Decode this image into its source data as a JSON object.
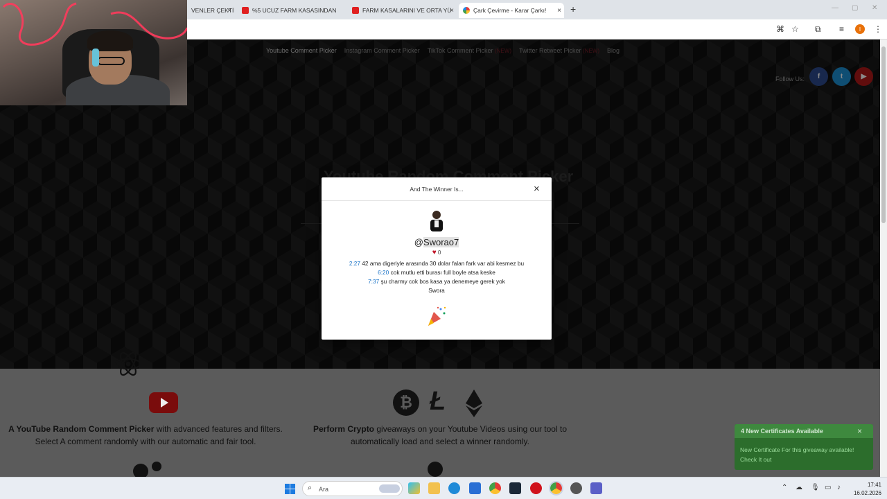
{
  "browser": {
    "tabs": [
      {
        "label": "VENLER ÇEKTİ",
        "icon": "none"
      },
      {
        "label": "%5 UCUZ FARM KASASINDAN ",
        "icon": "youtube-icon"
      },
      {
        "label": "FARM KASALARINI VE ORTA YÜ",
        "icon": "youtube-icon"
      },
      {
        "label": "Çark Çevirme - Karar Çarkı!",
        "icon": "wheel-icon"
      }
    ],
    "new_tab": "+",
    "close_glyph": "×"
  },
  "site": {
    "nav": [
      {
        "label": "Youtube Comment Picker",
        "badge": ""
      },
      {
        "label": "Instagram Comment Picker",
        "badge": ""
      },
      {
        "label": "TikTok Comment Picker",
        "badge": "(NEW)"
      },
      {
        "label": "Twitter Retweet Picker",
        "badge": "(NEW)"
      },
      {
        "label": "Blog",
        "badge": ""
      }
    ],
    "follow_label": "Follow Us:",
    "social": {
      "facebook": "f",
      "twitter": "t",
      "youtube": "▶"
    },
    "hero_title": "Youtube Random Comment Picker",
    "features": [
      {
        "bold": "A YouTube Random Comment Picker",
        "rest": " with advanced features and filters. Select A comment randomly with our automatic and fair tool."
      },
      {
        "bold": "Perform Crypto",
        "rest": " giveaways on your Youtube Videos using our tool to automatically load and select a winner randomly."
      }
    ],
    "crypto_icons": {
      "bitcoin": "₿",
      "litecoin": "Ł"
    }
  },
  "modal": {
    "title": "And The Winner Is...",
    "close": "×",
    "winner_prefix": "@",
    "winner_name": "Sworao7",
    "likes": "0",
    "comments": [
      {
        "ts": "2:27",
        "text": " 42 ama digeriyle arasında 30 dolar falan fark var abi kesmez bu"
      },
      {
        "ts": "6:20",
        "text": " cok mutlu etti burası full boyle atsa keske"
      },
      {
        "ts": "7:37",
        "text": " şu charmy cok bos kasa ya denemeye gerek yok"
      },
      {
        "ts": "",
        "text": "Swora"
      }
    ]
  },
  "notification": {
    "title": "4 New Certificates Available",
    "message": "New Certificate For this giveaway available! Check It out",
    "close": "×"
  },
  "taskbar": {
    "search_placeholder": "Ara",
    "time": "17:41",
    "date": "16.02.2026"
  }
}
